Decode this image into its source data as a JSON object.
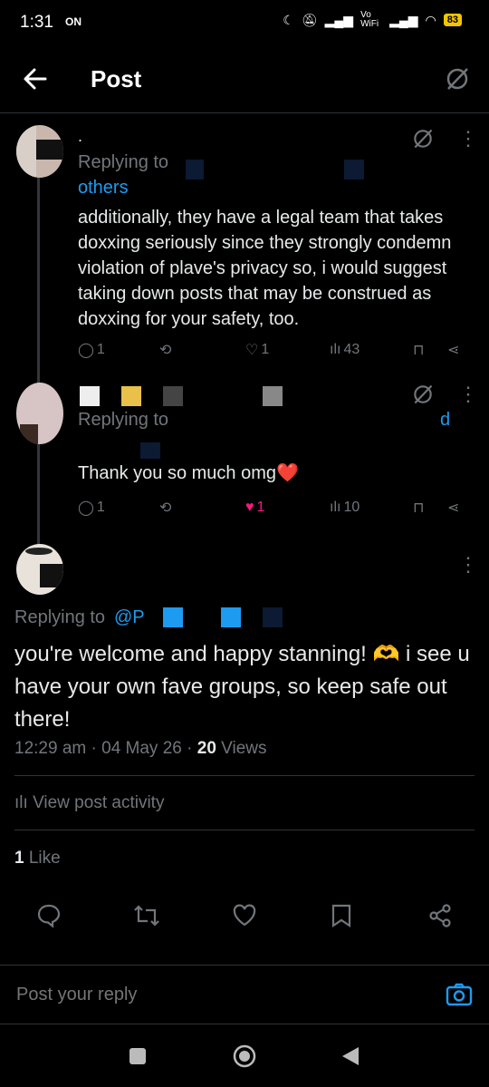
{
  "status": {
    "time": "1:31",
    "nfc": "ON",
    "network": "Vo WiFi",
    "battery": "83"
  },
  "header": {
    "title": "Post"
  },
  "post1": {
    "name": ".",
    "replying_prefix": "Replying to",
    "replying_suffix": "others",
    "text": "additionally, they have a legal team that takes doxxing seriously since they strongly condemn violation of plave's privacy so, i would suggest taking down posts that may be construed as doxxing for your safety, too.",
    "replies": "1",
    "reposts": "",
    "likes": "1",
    "views": "43"
  },
  "post2": {
    "replying_prefix": "Replying to",
    "replying_end": "d",
    "text": "Thank you so much omg❤️",
    "replies": "1",
    "reposts": "",
    "likes": "1",
    "views": "10",
    "like_color": "#f91880"
  },
  "main": {
    "replying_prefix": "Replying to",
    "replying_handle": "@P",
    "text": "you're welcome and happy stanning! 🫶 i see u have your own fave groups, so keep safe out there!",
    "time": "12:29 am",
    "date": "04 May 26",
    "views_count": "20",
    "views_label": "Views",
    "activity": "View post activity",
    "likes_count": "1",
    "likes_label": "Like"
  },
  "reply": {
    "placeholder": "Post your reply"
  },
  "colors": {
    "accent": "#1d9bf0",
    "muted": "#71767b",
    "text": "#e7e9ea",
    "like": "#f91880"
  }
}
